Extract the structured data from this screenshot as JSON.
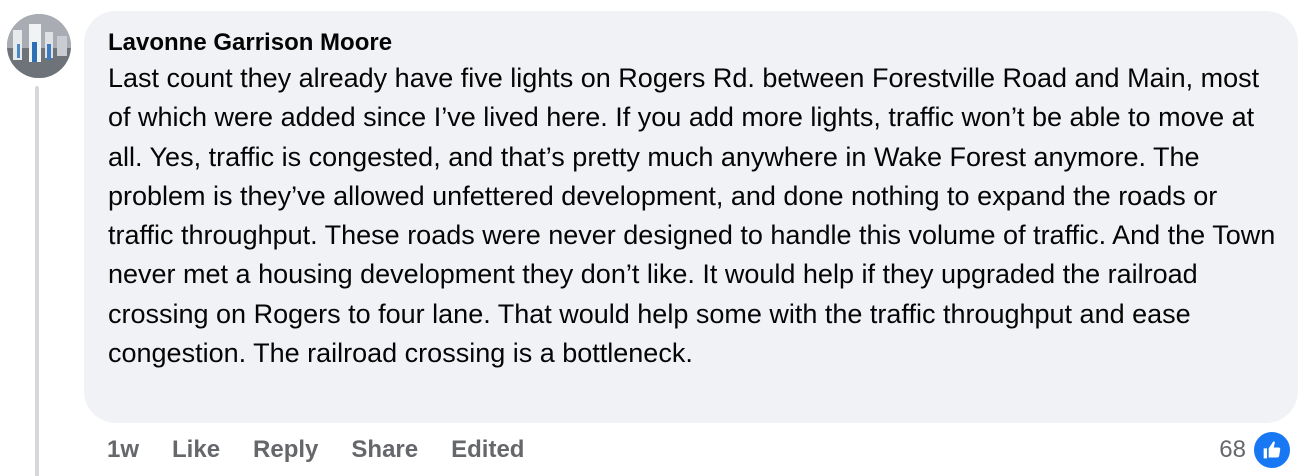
{
  "comment": {
    "author": "Lavonne Garrison Moore",
    "text": "Last count they already have five lights on Rogers Rd. between Forestville Road and Main, most of which were added since I’ve lived here. If you add more lights, traffic won’t be able to move at all. Yes, traffic is congested, and that’s pretty much anywhere in Wake Forest anymore. The problem is they’ve allowed unfettered development, and done nothing to expand the roads or traffic throughput. These roads were never designed to handle this volume of traffic. And the Town never met a housing development they don’t like. It would help if they upgraded the railroad crossing on Rogers to four lane. That would help some with the traffic throughput and ease congestion. The railroad crossing is a bottleneck.",
    "avatar_icon": "user-avatar"
  },
  "actions": {
    "time": "1w",
    "like": "Like",
    "reply": "Reply",
    "share": "Share",
    "edited": "Edited"
  },
  "reactions": {
    "count": "68",
    "icon": "thumbs-up-icon",
    "color": "#1877f2"
  },
  "colors": {
    "bubble": "#f0f2f5",
    "text": "#050505",
    "secondary": "#65676b",
    "thread_line": "#d6d8dc"
  }
}
